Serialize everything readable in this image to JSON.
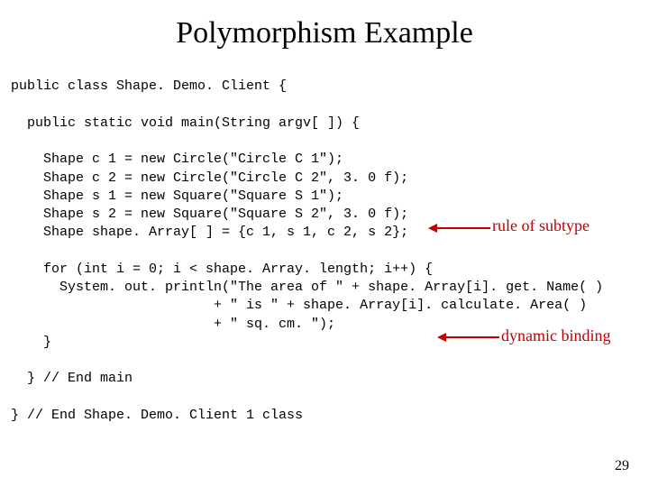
{
  "title": "Polymorphism Example",
  "code": {
    "l1": "public class Shape. Demo. Client {",
    "l2": "",
    "l3": "  public static void main(String argv[ ]) {",
    "l4": "",
    "l5": "    Shape c 1 = new Circle(\"Circle C 1\");",
    "l6": "    Shape c 2 = new Circle(\"Circle C 2\", 3. 0 f);",
    "l7": "    Shape s 1 = new Square(\"Square S 1\");",
    "l8": "    Shape s 2 = new Square(\"Square S 2\", 3. 0 f);",
    "l9": "    Shape shape. Array[ ] = {c 1, s 1, c 2, s 2};",
    "l10": "",
    "l11": "    for (int i = 0; i < shape. Array. length; i++) {",
    "l12": "      System. out. println(\"The area of \" + shape. Array[i]. get. Name( )",
    "l13": "                         + \" is \" + shape. Array[i]. calculate. Area( )",
    "l14": "                         + \" sq. cm. \");",
    "l15": "    }",
    "l16": "",
    "l17": "  } // End main",
    "l18": "",
    "l19": "} // End Shape. Demo. Client 1 class"
  },
  "annotations": {
    "rule_of_subtype": "rule of subtype",
    "dynamic_binding": "dynamic binding"
  },
  "page_number": "29"
}
